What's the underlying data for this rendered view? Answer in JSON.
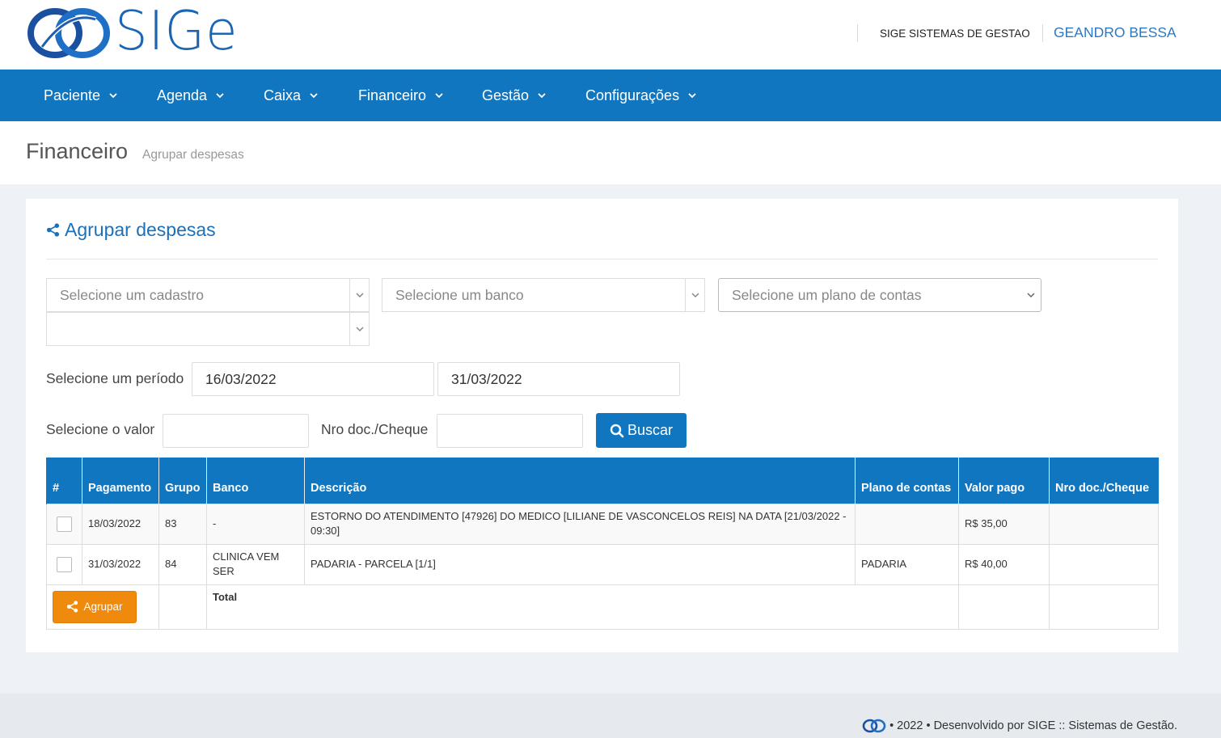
{
  "header": {
    "logo_text": "SIGe",
    "company": "SIGE SISTEMAS DE GESTAO",
    "user": "GEANDRO BESSA"
  },
  "nav": {
    "items": [
      {
        "label": "Paciente"
      },
      {
        "label": "Agenda"
      },
      {
        "label": "Caixa"
      },
      {
        "label": "Financeiro"
      },
      {
        "label": "Gestão"
      },
      {
        "label": "Configurações"
      }
    ]
  },
  "page": {
    "title": "Financeiro",
    "breadcrumb": "Agrupar despesas"
  },
  "card": {
    "title": "Agrupar despesas",
    "filters": {
      "cadastro_placeholder": "Selecione um cadastro",
      "banco_placeholder": "Selecione um banco",
      "plano_placeholder": "Selecione um plano de contas",
      "extra_value": "",
      "periodo_label": "Selecione um período",
      "date_from": "16/03/2022",
      "date_to": "31/03/2022",
      "valor_label": "Selecione o valor",
      "valor_value": "",
      "doc_label": "Nro doc./Cheque",
      "doc_value": "",
      "search_button": "Buscar"
    },
    "table": {
      "headers": [
        "#",
        "Pagamento",
        "Grupo",
        "Banco",
        "Descrição",
        "Plano de contas",
        "Valor pago",
        "Nro doc./Cheque"
      ],
      "rows": [
        {
          "checked": false,
          "pagamento": "18/03/2022",
          "grupo": "83",
          "banco": "-",
          "descricao": "ESTORNO DO ATENDIMENTO [47926] DO MEDICO [LILIANE DE VASCONCELOS REIS] NA DATA [21/03/2022 - 09:30]",
          "plano": "",
          "valor": "R$ 35,00",
          "doc": ""
        },
        {
          "checked": false,
          "pagamento": "31/03/2022",
          "grupo": "84",
          "banco": "CLINICA VEM SER",
          "descricao": "PADARIA - PARCELA [1/1]",
          "plano": "PADARIA",
          "valor": "R$ 40,00",
          "doc": ""
        }
      ],
      "total_label": "Total",
      "total_value": "",
      "group_button": "Agrupar"
    }
  },
  "footer": {
    "text": "• 2022 • Desenvolvido por SIGE :: Sistemas de Gestão."
  },
  "colors": {
    "primary": "#1176c0",
    "accent": "#f08a0c"
  },
  "icons": [
    "sige-logo-icon",
    "chevron-down-icon",
    "share-icon",
    "search-icon"
  ]
}
